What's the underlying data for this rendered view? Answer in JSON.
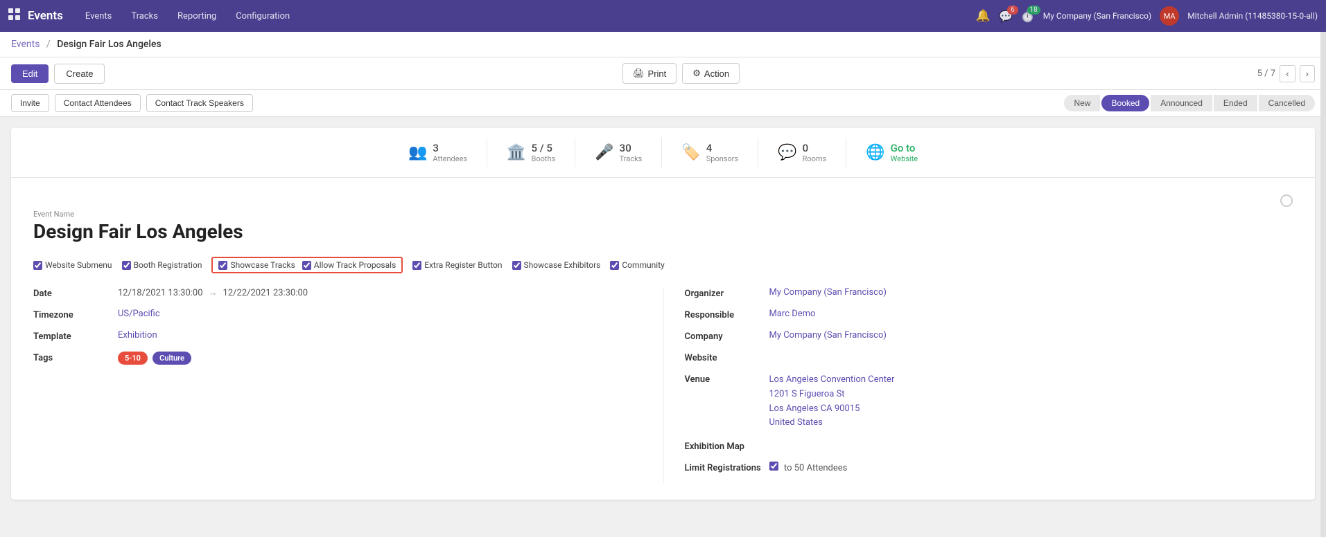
{
  "topnav": {
    "app_name": "Events",
    "nav_links": [
      "Events",
      "Tracks",
      "Reporting",
      "Configuration"
    ],
    "notifications_count": "6",
    "messages_count": "18",
    "company": "My Company (San Francisco)",
    "user": "Mitchell Admin (11485380-15-0-all)"
  },
  "breadcrumb": {
    "parent": "Events",
    "separator": "/",
    "current": "Design Fair Los Angeles"
  },
  "toolbar": {
    "edit_label": "Edit",
    "create_label": "Create",
    "print_label": "Print",
    "action_label": "Action",
    "pager": "5 / 7"
  },
  "action_buttons": {
    "invite": "Invite",
    "contact_attendees": "Contact Attendees",
    "contact_track_speakers": "Contact Track Speakers"
  },
  "status_buttons": {
    "new": "New",
    "booked": "Booked",
    "announced": "Announced",
    "ended": "Ended",
    "cancelled": "Cancelled",
    "active": "Booked"
  },
  "stats": [
    {
      "icon": "👥",
      "number": "3",
      "label": "Attendees"
    },
    {
      "icon": "🏛️",
      "number": "5 / 5",
      "label": "Booths"
    },
    {
      "icon": "🎤",
      "number": "30",
      "label": "Tracks"
    },
    {
      "icon": "🏷️",
      "number": "4",
      "label": "Sponsors"
    },
    {
      "icon": "💬",
      "number": "0",
      "label": "Rooms"
    },
    {
      "icon": "🌐",
      "number": "Go to",
      "label": "Website",
      "is_link": true
    }
  ],
  "event": {
    "name_label": "Event Name",
    "title": "Design Fair Los Angeles",
    "checkboxes": [
      {
        "id": "website_submenu",
        "label": "Website Submenu",
        "checked": true
      },
      {
        "id": "booth_registration",
        "label": "Booth Registration",
        "checked": true
      },
      {
        "id": "showcase_tracks",
        "label": "Showcase Tracks",
        "checked": true,
        "highlight": true
      },
      {
        "id": "allow_track_proposals",
        "label": "Allow Track Proposals",
        "checked": true,
        "highlight": true
      },
      {
        "id": "extra_register_button",
        "label": "Extra Register Button",
        "checked": true
      },
      {
        "id": "showcase_exhibitors",
        "label": "Showcase Exhibitors",
        "checked": true
      },
      {
        "id": "community",
        "label": "Community",
        "checked": true
      }
    ],
    "date_label": "Date",
    "date_start": "12/18/2021 13:30:00",
    "date_end": "12/22/2021 23:30:00",
    "timezone_label": "Timezone",
    "timezone": "US/Pacific",
    "template_label": "Template",
    "template": "Exhibition",
    "tags_label": "Tags",
    "tags": [
      {
        "label": "5-10",
        "color": "red"
      },
      {
        "label": "Culture",
        "color": "purple"
      }
    ],
    "organizer_label": "Organizer",
    "organizer": "My Company (San Francisco)",
    "responsible_label": "Responsible",
    "responsible": "Marc Demo",
    "company_label": "Company",
    "company": "My Company (San Francisco)",
    "website_label": "Website",
    "website": "",
    "venue_label": "Venue",
    "venue_line1": "Los Angeles Convention Center",
    "venue_line2": "1201 S Figueroa St",
    "venue_line3": "Los Angeles CA 90015",
    "venue_line4": "United States",
    "exhibition_map_label": "Exhibition Map",
    "limit_registrations_label": "Limit Registrations",
    "limit_registrations_value": "to 50 Attendees"
  }
}
